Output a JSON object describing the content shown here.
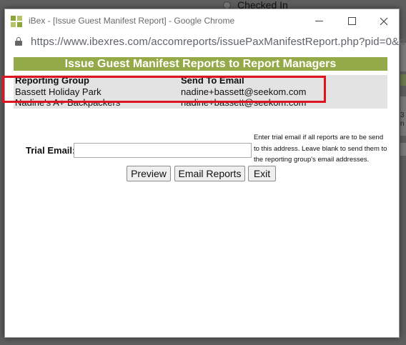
{
  "background": {
    "radio_label": "Checked In",
    "strip_texts": [
      "3",
      "n"
    ]
  },
  "window": {
    "title": "iBex - [Issue Guest Manifest Report] - Google Chrome",
    "url": "https://www.ibexres.com/accomreports/issuePaxManifestReport.php?pid=0&d..."
  },
  "report": {
    "header": "Issue Guest Manifest Reports to Report Managers",
    "columns": {
      "group": "Reporting Group",
      "email": "Send To Email"
    },
    "rows": [
      {
        "group": "Bassett Holiday Park",
        "email": "nadine+bassett@seekom.com"
      },
      {
        "group": "Nadine's A+ Backpackers",
        "email": "nadine+bassett@seekom.com"
      }
    ]
  },
  "trial": {
    "label": "Trial Email:",
    "value": "",
    "help": "Enter trial email if all reports are to be send to this address. Leave blank to send them to the reporting group's email addresses."
  },
  "buttons": {
    "preview": "Preview",
    "email": "Email Reports",
    "exit": "Exit"
  },
  "colors": {
    "header_bg": "#94a947",
    "highlight": "#e0141e",
    "table_bg": "#e3e3e3"
  }
}
